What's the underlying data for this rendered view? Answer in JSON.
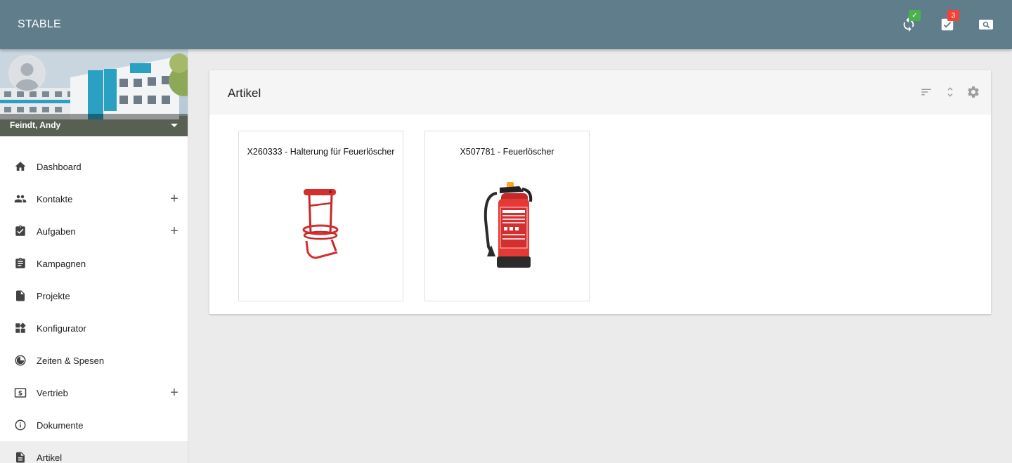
{
  "app": {
    "title": "STABLE"
  },
  "topbar": {
    "icons": [
      {
        "name": "sync-icon",
        "badge": "✓",
        "badge_color": "#4caf50"
      },
      {
        "name": "tasks-icon",
        "badge": "3",
        "badge_color": "#f44336"
      },
      {
        "name": "search-icon"
      }
    ]
  },
  "profile": {
    "name": "Feindt, Andy"
  },
  "sidebar": {
    "items": [
      {
        "label": "Dashboard",
        "icon": "home-icon",
        "expandable": false
      },
      {
        "label": "Kontakte",
        "icon": "people-icon",
        "expandable": true
      },
      {
        "label": "Aufgaben",
        "icon": "assignment-check-icon",
        "expandable": true
      },
      {
        "label": "Kampagnen",
        "icon": "clipboard-icon",
        "expandable": false
      },
      {
        "label": "Projekte",
        "icon": "file-icon",
        "expandable": false
      },
      {
        "label": "Konfigurator",
        "icon": "dashboard-tiles-icon",
        "expandable": false
      },
      {
        "label": "Zeiten & Spesen",
        "icon": "clock-icon",
        "expandable": false
      },
      {
        "label": "Vertrieb",
        "icon": "money-icon",
        "expandable": true
      },
      {
        "label": "Dokumente",
        "icon": "info-icon",
        "expandable": false
      },
      {
        "label": "Artikel",
        "icon": "article-icon",
        "expandable": false,
        "active": true
      }
    ],
    "plus_symbol": "+"
  },
  "main": {
    "title": "Artikel",
    "header_icons": [
      "sort-icon",
      "expand-icon",
      "settings-icon"
    ],
    "articles": [
      {
        "title": "X260333 - Halterung für Feuerlöscher",
        "image": "bracket-image"
      },
      {
        "title": "X507781 - Feuerlöscher",
        "image": "extinguisher-image"
      }
    ]
  },
  "colors": {
    "topbar": "#607d8b",
    "background": "#ebebeb",
    "accent_red": "#d32f2f",
    "badge_green": "#4caf50",
    "badge_red": "#f44336"
  }
}
